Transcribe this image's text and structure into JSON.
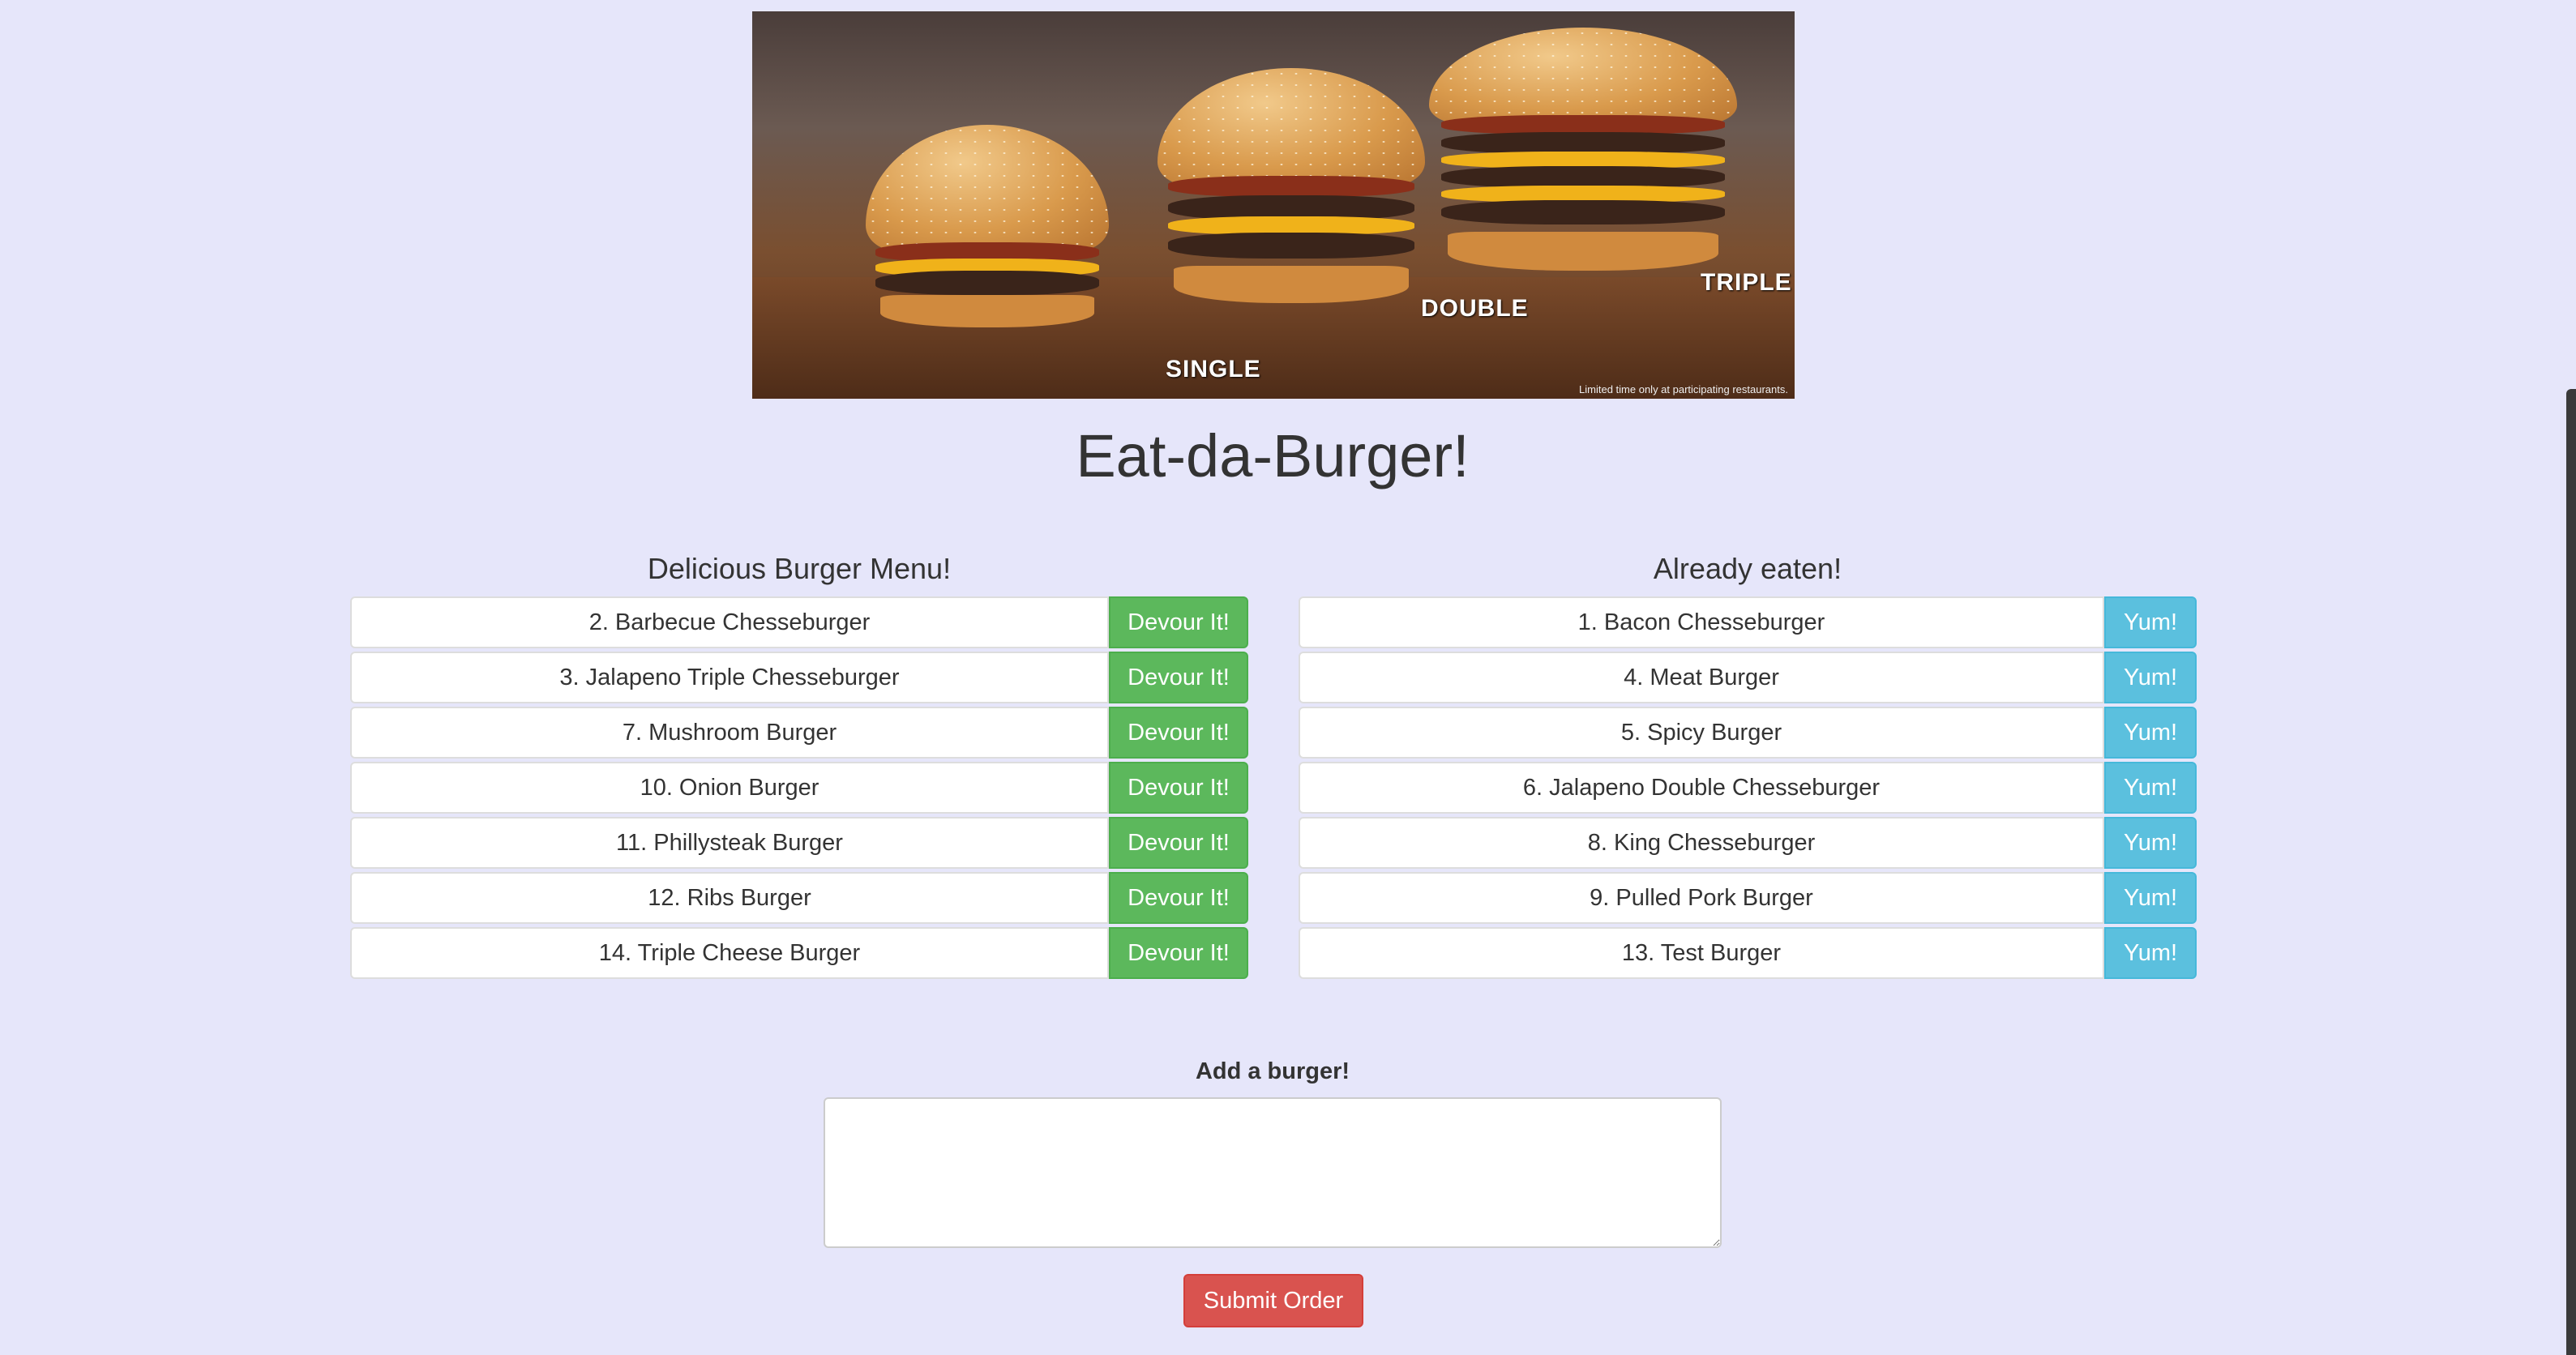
{
  "hero": {
    "labels": [
      "SINGLE",
      "DOUBLE",
      "TRIPLE"
    ],
    "fine_print": "Limited time only at participating restaurants."
  },
  "page_title": "Eat-da-Burger!",
  "menu": {
    "heading": "Delicious Burger Menu!",
    "button_label": "Devour It!",
    "items": [
      "2. Barbecue Chesseburger",
      "3. Jalapeno Triple Chesseburger",
      "7. Mushroom Burger",
      "10. Onion Burger",
      "11. Phillysteak Burger",
      "12. Ribs Burger",
      "14. Triple Cheese Burger"
    ]
  },
  "eaten": {
    "heading": "Already eaten!",
    "button_label": "Yum!",
    "items": [
      "1. Bacon Chesseburger",
      "4. Meat Burger",
      "5. Spicy Burger",
      "6. Jalapeno Double Chesseburger",
      "8. King Chesseburger",
      "9. Pulled Pork Burger",
      "13. Test Burger"
    ]
  },
  "form": {
    "label": "Add a burger!",
    "value": "",
    "submit_label": "Submit Order"
  },
  "colors": {
    "background": "#e6e6fa",
    "devour": "#5cb85c",
    "yum": "#5bc0de",
    "submit": "#d9534f"
  }
}
